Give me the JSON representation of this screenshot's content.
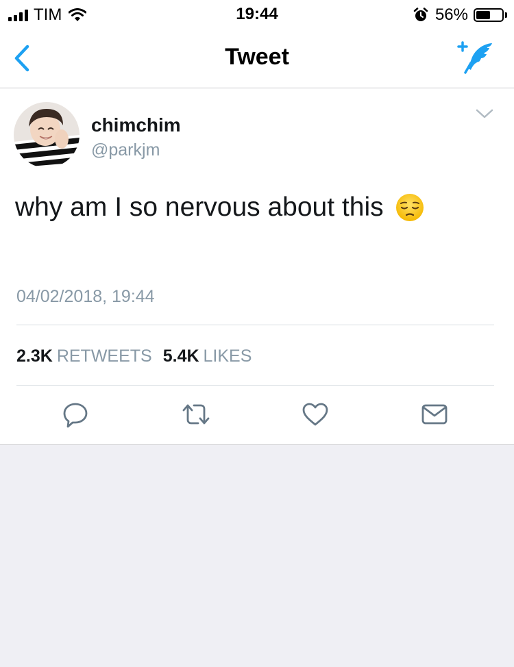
{
  "status_bar": {
    "carrier": "TIM",
    "time": "19:44",
    "battery_percent": "56%",
    "battery_level": 0.56,
    "icons": [
      "signal-icon",
      "wifi-icon",
      "alarm-icon",
      "battery-icon"
    ]
  },
  "nav": {
    "title": "Tweet",
    "back_icon": "chevron-left-icon",
    "compose_icon": "compose-tweet-icon"
  },
  "tweet": {
    "display_name": "chimchim",
    "username": "@parkjm",
    "text": "why am I so nervous about this",
    "emoji": "pensive-face-emoji",
    "timestamp": "04/02/2018, 19:44",
    "retweets_count": "2.3K",
    "retweets_label": "RETWEETS",
    "likes_count": "5.4K",
    "likes_label": "LIKES",
    "actions": [
      "reply-icon",
      "retweet-icon",
      "like-icon",
      "direct-message-icon"
    ]
  },
  "colors": {
    "accent": "#1da1f2",
    "secondary_text": "#8899a6",
    "primary_text": "#14171a",
    "background": "#efeff4"
  }
}
